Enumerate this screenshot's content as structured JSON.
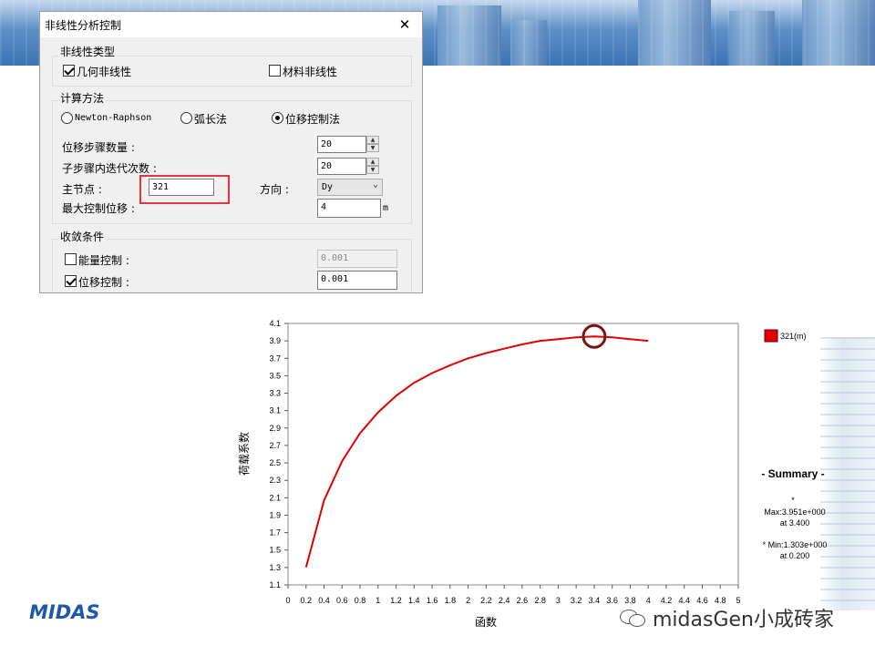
{
  "dialog": {
    "title": "非线性分析控制",
    "close_label": "✕",
    "type_group": {
      "title": "非线性类型",
      "geometric": {
        "label": "几何非线性",
        "checked": true
      },
      "material": {
        "label": "材料非线性",
        "checked": false
      }
    },
    "method_group": {
      "title": "计算方法",
      "options": [
        {
          "label": "Newton-Raphson",
          "selected": false
        },
        {
          "label": "弧长法",
          "selected": false
        },
        {
          "label": "位移控制法",
          "selected": true
        }
      ],
      "steps_label": "位移步骤数量 :",
      "steps_value": "20",
      "iter_label": "子步骤内迭代次数 :",
      "iter_value": "20",
      "master_node_label": "主节点 :",
      "master_node_value": "321",
      "direction_label": "方向 :",
      "direction_value": "Dy",
      "max_disp_label": "最大控制位移 :",
      "max_disp_value": "4",
      "max_disp_unit": "m"
    },
    "conv_group": {
      "title": "收敛条件",
      "energy": {
        "label": "能量控制 :",
        "checked": false,
        "value": "0.001"
      },
      "displacement": {
        "label": "位移控制 :",
        "checked": true,
        "value": "0.001"
      }
    }
  },
  "chart_data": {
    "type": "line",
    "xlabel": "函数",
    "ylabel": "荷载系数",
    "xlim": [
      0,
      5
    ],
    "ylim": [
      1.1,
      4.1
    ],
    "xticks": [
      "0",
      "0.2",
      "0.4",
      "0.6",
      "0.8",
      "1",
      "1.2",
      "1.4",
      "1.6",
      "1.8",
      "2",
      "2.2",
      "2.4",
      "2.6",
      "2.8",
      "3",
      "3.2",
      "3.4",
      "3.6",
      "3.8",
      "4",
      "4.2",
      "4.4",
      "4.6",
      "4.8",
      "5"
    ],
    "yticks": [
      "1.1",
      "1.3",
      "1.5",
      "1.7",
      "1.9",
      "2.1",
      "2.3",
      "2.5",
      "2.7",
      "2.9",
      "3.1",
      "3.3",
      "3.5",
      "3.7",
      "3.9",
      "4.1"
    ],
    "series": [
      {
        "name": "321(m)",
        "color": "#e00000",
        "x": [
          0.2,
          0.4,
          0.6,
          0.8,
          1.0,
          1.2,
          1.4,
          1.6,
          1.8,
          2.0,
          2.2,
          2.4,
          2.6,
          2.8,
          3.0,
          3.2,
          3.4,
          3.6,
          3.8,
          4.0
        ],
        "y": [
          1.303,
          2.07,
          2.52,
          2.84,
          3.08,
          3.27,
          3.42,
          3.53,
          3.62,
          3.7,
          3.76,
          3.81,
          3.86,
          3.9,
          3.92,
          3.94,
          3.951,
          3.94,
          3.92,
          3.9
        ]
      }
    ],
    "highlight_point": {
      "x": 3.4,
      "y": 3.951
    },
    "summary": {
      "title": "- Summary -",
      "star": "*",
      "max_line": "Max:3.951e+000",
      "max_at": "at  3.400",
      "min_line": "* Min:1.303e+000",
      "min_at": "at  0.200"
    }
  },
  "branding": {
    "logo": "MIDAS",
    "watermark": "midasGen小成砖家"
  }
}
